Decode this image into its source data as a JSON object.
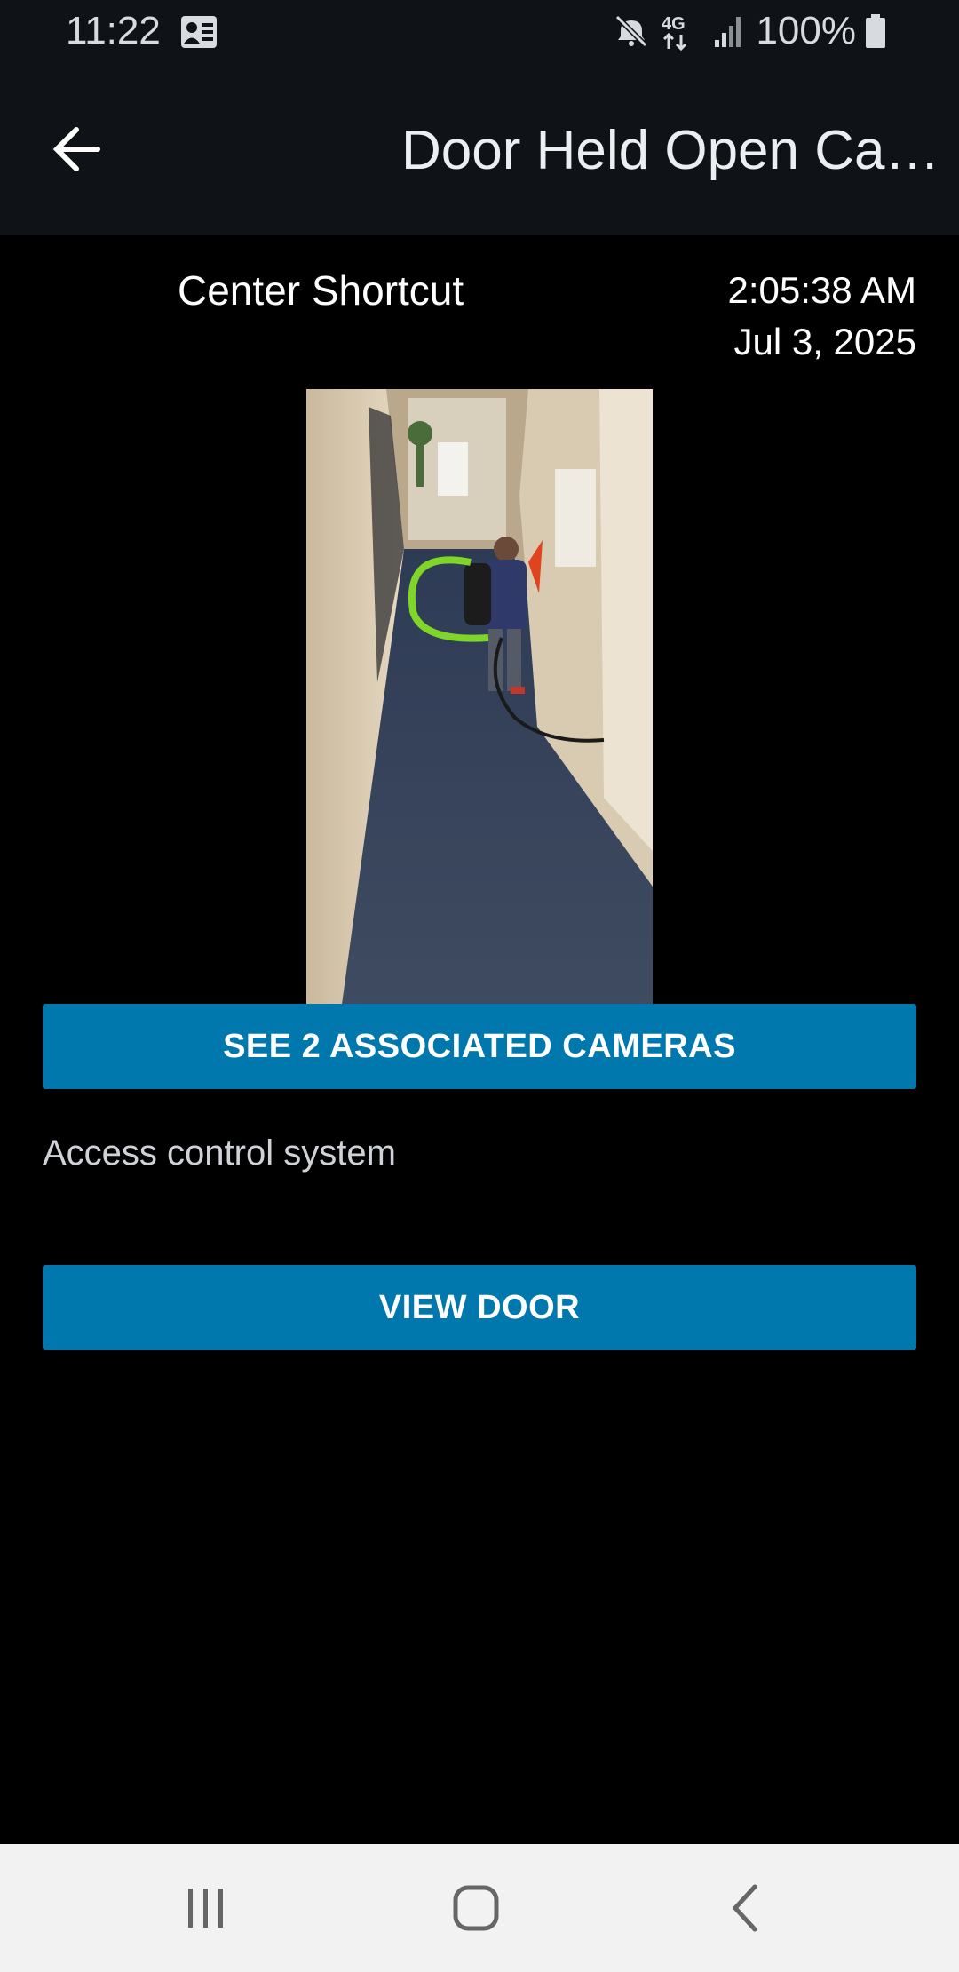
{
  "status_bar": {
    "time": "11:22",
    "network": "4G",
    "battery": "100%",
    "icons": [
      "contact-card-icon",
      "mute-icon",
      "lte-data-icon",
      "signal-icon",
      "battery-icon"
    ]
  },
  "app_bar": {
    "title": "Door Held Open Ca…",
    "back_icon": "arrow-left-icon"
  },
  "event": {
    "camera_name": "Center Shortcut",
    "time": "2:05:38 AM",
    "date": "Jul 3, 2025"
  },
  "actions": {
    "associated_cameras_label": "SEE 2 ASSOCIATED CAMERAS",
    "view_door_label": "VIEW DOOR"
  },
  "source_label": "Access control system",
  "nav_bar": {
    "icons": [
      "recent-apps-icon",
      "home-icon",
      "back-icon"
    ]
  },
  "colors": {
    "background": "#000000",
    "app_bar": "#0f1216",
    "accent": "#0077ad",
    "nav_bar": "#f2f2f2"
  }
}
